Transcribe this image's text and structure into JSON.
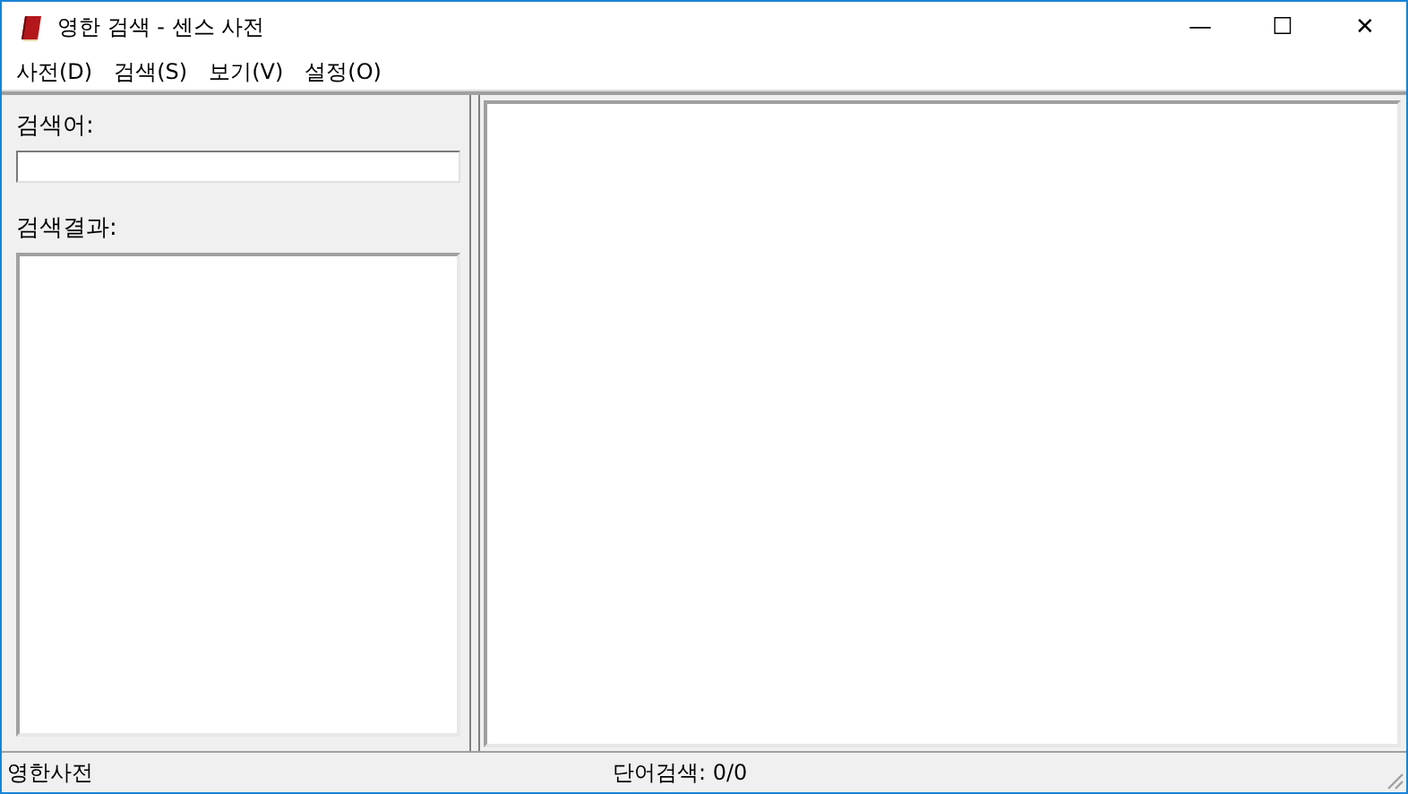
{
  "window": {
    "title": "영한 검색 - 센스 사전",
    "controls": [
      "—",
      "☐",
      "✕"
    ]
  },
  "menu": [
    {
      "label": "사전(D)"
    },
    {
      "label": "검색(S)"
    },
    {
      "label": "보기(V)"
    },
    {
      "label": "설정(O)"
    }
  ],
  "search": {
    "label": "검색어:"
  },
  "results": {
    "label": "검색결과:"
  },
  "status_bar": {
    "left": "영한사전",
    "center": "단어검색: 0/0"
  }
}
